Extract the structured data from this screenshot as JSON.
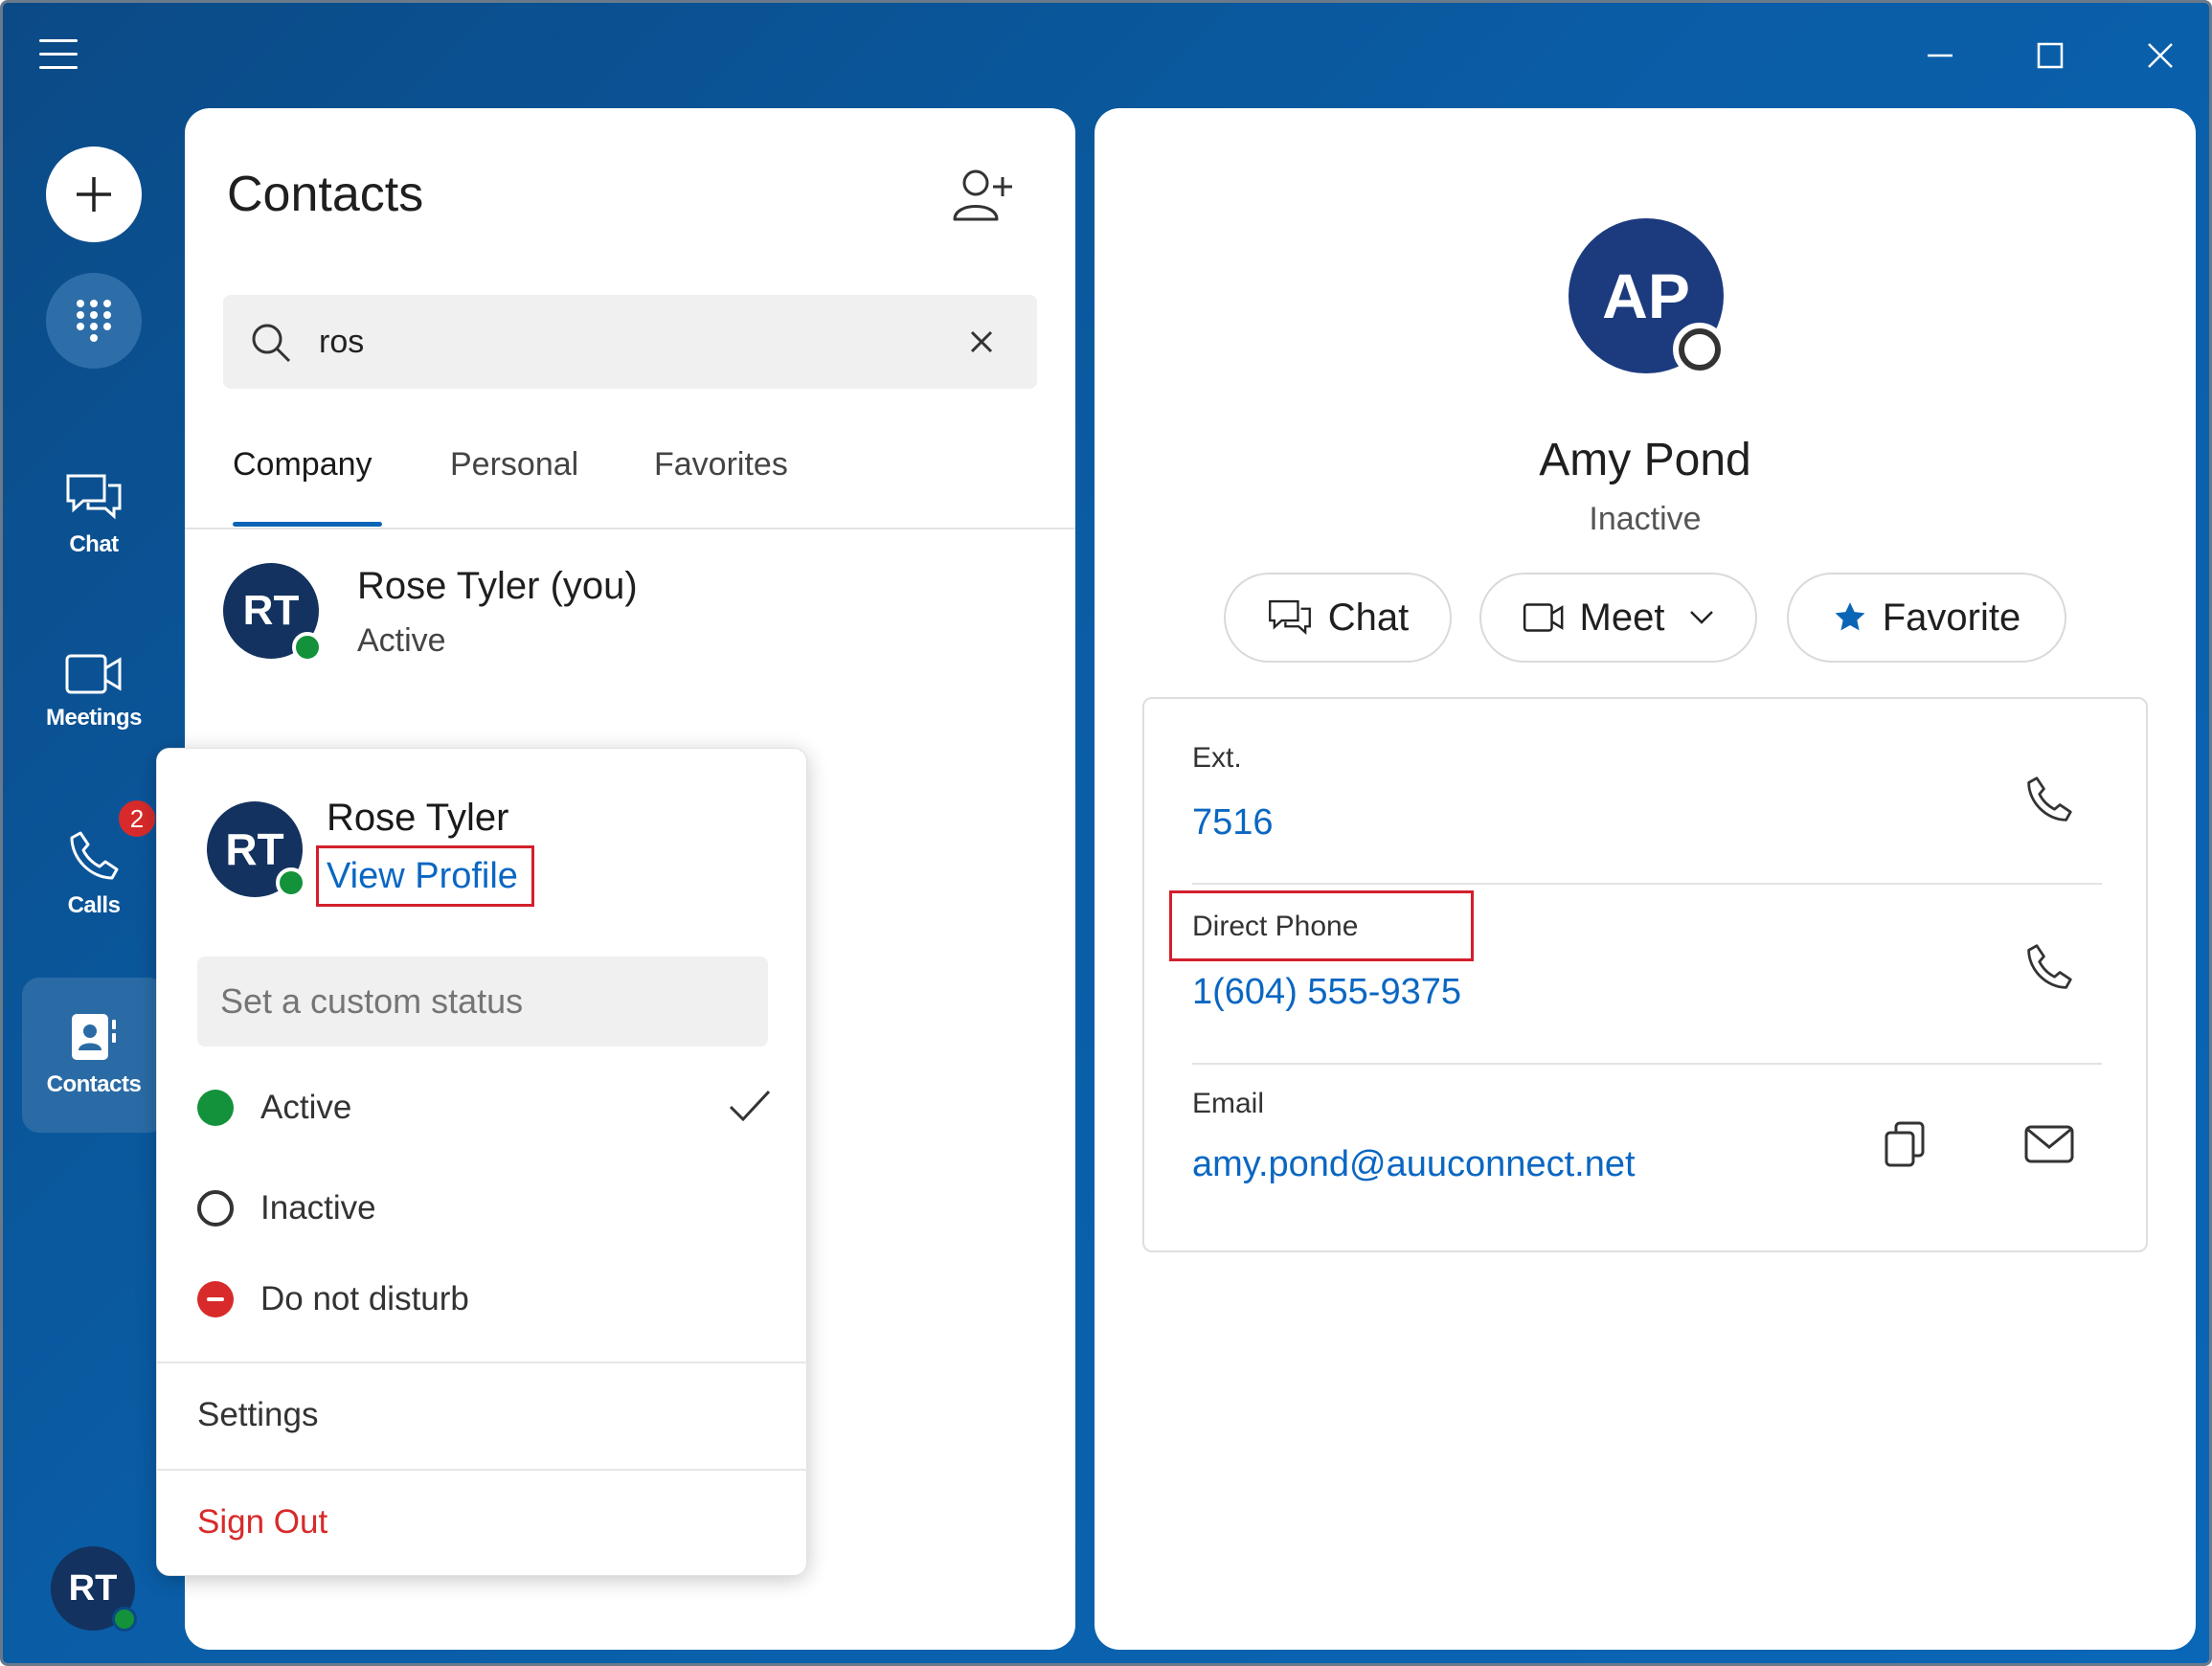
{
  "window": {
    "accent": "#0a5da6",
    "controls": [
      "minimize-icon",
      "maximize-icon",
      "close-icon"
    ]
  },
  "rail": {
    "new_icon": "plus-icon",
    "dialpad_icon": "dialpad-icon",
    "items": [
      {
        "label": "Chat",
        "icon": "chat-icon"
      },
      {
        "label": "Meetings",
        "icon": "video-camera-icon"
      },
      {
        "label": "Calls",
        "icon": "phone-icon",
        "badge": "2"
      },
      {
        "label": "Contacts",
        "icon": "contact-card-icon",
        "active": true
      }
    ],
    "user_initials": "RT"
  },
  "contacts": {
    "title": "Contacts",
    "add_icon": "add-contact-icon",
    "search": {
      "value": "ros",
      "placeholder": "Search"
    },
    "tabs": [
      {
        "label": "Company",
        "active": true
      },
      {
        "label": "Personal"
      },
      {
        "label": "Favorites"
      }
    ],
    "results": [
      {
        "initials": "RT",
        "name": "Rose Tyler (you)",
        "status": "Active"
      }
    ]
  },
  "status_menu": {
    "initials": "RT",
    "name": "Rose Tyler",
    "view_profile": "View Profile",
    "custom_status_placeholder": "Set a custom status",
    "options": [
      {
        "label": "Active",
        "color": "#13923b",
        "selected": true
      },
      {
        "label": "Inactive",
        "color": "#333333"
      },
      {
        "label": "Do not disturb",
        "color": "#d82a2a"
      }
    ],
    "settings": "Settings",
    "sign_out": "Sign Out",
    "sign_out_color": "#d82a2a"
  },
  "detail": {
    "initials": "AP",
    "name": "Amy Pond",
    "status": "Inactive",
    "actions": {
      "chat": "Chat",
      "meet": "Meet",
      "favorite": "Favorite"
    },
    "fields": [
      {
        "label": "Ext.",
        "value": "7516"
      },
      {
        "label": "Direct Phone",
        "value": "1(604) 555-9375"
      },
      {
        "label": "Email",
        "value": "amy.pond@auuconnect.net"
      }
    ]
  }
}
